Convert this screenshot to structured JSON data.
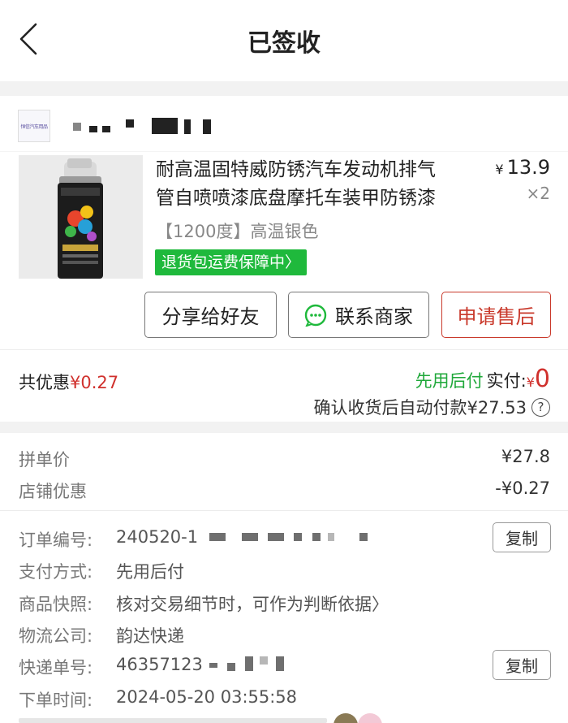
{
  "header": {
    "title": "已签收",
    "back_icon": "chevron-left-icon"
  },
  "product": {
    "title_line1": "耐高温固特威防锈汽车发动机排气",
    "title_line2": "管自喷喷漆底盘摩托车装甲防锈漆",
    "currency": "¥",
    "price": "13.9",
    "quantity": "×2",
    "spec": "【1200度】高温银色",
    "guarantee": "退货包运费保障中〉"
  },
  "actions": {
    "share": "分享给好友",
    "contact": "联系商家",
    "aftersale": "申请售后"
  },
  "summary": {
    "discount_label": "共优惠",
    "discount_amount": "¥0.27",
    "pay_later": "先用后付",
    "actual_label": "实付:",
    "actual_currency": "¥",
    "actual_amount": "0",
    "autopay_text": "确认收货后自动付款¥27.53",
    "help_icon": "?"
  },
  "pricing": {
    "group_price_label": "拼单价",
    "group_price_value": "¥27.8",
    "store_discount_label": "店铺优惠",
    "store_discount_value": "-¥0.27"
  },
  "order": {
    "order_no_label": "订单编号:",
    "order_no_value": "240520-1",
    "copy_label": "复制",
    "payment_label": "支付方式:",
    "payment_value": "先用后付",
    "snapshot_label": "商品快照:",
    "snapshot_value": "核对交易细节时，可作为判断依据〉",
    "courier_label": "物流公司:",
    "courier_value": "韵达快递",
    "tracking_label": "快递单号:",
    "tracking_value": "46357123",
    "order_time_label": "下单时间:",
    "order_time_value": "2024-05-20 03:55:58"
  },
  "colors": {
    "red": "#d0312d",
    "green": "#1fb93c",
    "aftersale": "#c9392b"
  }
}
